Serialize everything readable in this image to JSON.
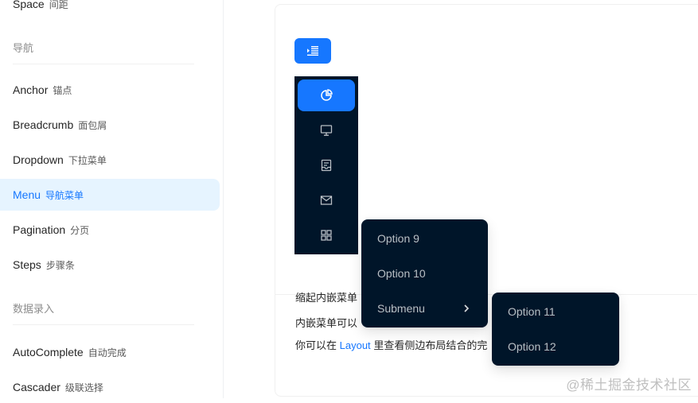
{
  "sidebar": {
    "items_top": [
      {
        "en": "Space",
        "cn": "间距"
      }
    ],
    "group_nav": "导航",
    "nav_items": [
      {
        "en": "Anchor",
        "cn": "锚点"
      },
      {
        "en": "Breadcrumb",
        "cn": "面包屑"
      },
      {
        "en": "Dropdown",
        "cn": "下拉菜单"
      },
      {
        "en": "Menu",
        "cn": "导航菜单"
      },
      {
        "en": "Pagination",
        "cn": "分页"
      },
      {
        "en": "Steps",
        "cn": "步骤条"
      }
    ],
    "group_input": "数据录入",
    "input_items": [
      {
        "en": "AutoComplete",
        "cn": "自动完成"
      },
      {
        "en": "Cascader",
        "cn": "级联选择"
      }
    ]
  },
  "demo": {
    "menu_icons": [
      "pie-chart-icon",
      "desktop-icon",
      "container-icon",
      "mail-icon",
      "appstore-icon"
    ],
    "popup": {
      "items": [
        "Option 9",
        "Option 10",
        "Submenu"
      ]
    },
    "subpopup": {
      "items": [
        "Option 11",
        "Option 12"
      ]
    },
    "title": "缩起内嵌菜单",
    "desc1": "内嵌菜单可以",
    "desc2_prefix": "你可以在",
    "desc2_link": "Layout",
    "desc2_suffix": "里查看侧边布局结合的完"
  },
  "watermark": "@稀土掘金技术社区",
  "colors": {
    "primary": "#1677ff",
    "dark": "#001529",
    "active_bg": "#e6f4ff"
  }
}
